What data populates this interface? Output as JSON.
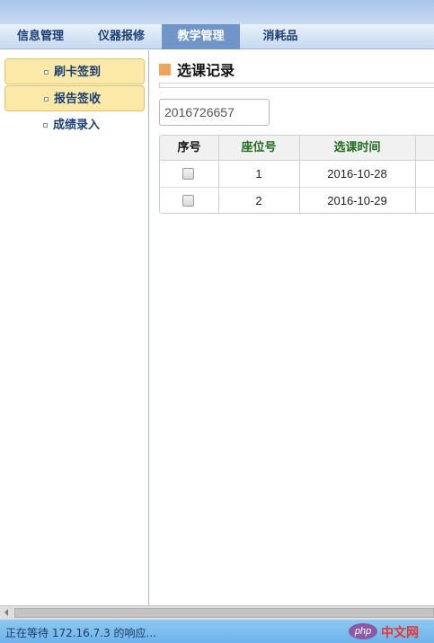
{
  "nav": {
    "tabs": [
      {
        "label": "信息管理"
      },
      {
        "label": "仪器报修"
      },
      {
        "label": "教学管理"
      },
      {
        "label": "消耗品"
      }
    ],
    "active_tab": "教学管理"
  },
  "sidebar": {
    "items": [
      {
        "label": "刷卡签到"
      },
      {
        "label": "报告签收"
      },
      {
        "label": "成绩录入"
      }
    ]
  },
  "main": {
    "section_title": "选课记录",
    "id_field_value": "2016726657",
    "table": {
      "columns": [
        "序号",
        "座位号",
        "选课时间"
      ],
      "rows": [
        {
          "seat": "1",
          "time": "2016-10-28"
        },
        {
          "seat": "2",
          "time": "2016-10-29"
        }
      ]
    }
  },
  "status": {
    "text": "正在等待 172.16.7.3 的响应..."
  },
  "watermark": {
    "logo": "php",
    "text": "中文网"
  },
  "colors": {
    "active_tab": "#6f95c9",
    "sidebar_highlight": "#fde9a7",
    "section_marker": "#f0a35a",
    "column_header_green": "#1f6b1f",
    "statusbar": "#7dbdee"
  }
}
